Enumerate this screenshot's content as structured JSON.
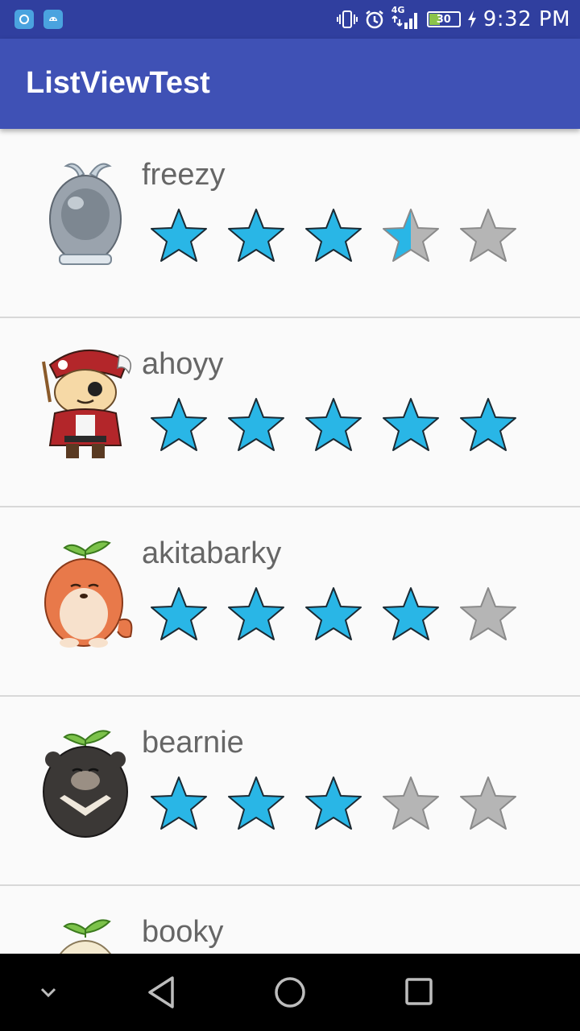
{
  "status_bar": {
    "time": "9:32 PM",
    "battery_level": "30",
    "network_type": "4G",
    "icons": [
      "app-notification-icon",
      "android-notification-icon",
      "vibrate-icon",
      "alarm-icon",
      "signal-icon",
      "battery-icon",
      "charging-icon"
    ]
  },
  "app_bar": {
    "title": "ListViewTest"
  },
  "list": {
    "items": [
      {
        "name": "freezy",
        "rating": 3.5,
        "max": 5
      },
      {
        "name": "ahoyy",
        "rating": 5,
        "max": 5
      },
      {
        "name": "akitabarky",
        "rating": 4,
        "max": 5
      },
      {
        "name": "bearnie",
        "rating": 3,
        "max": 5
      },
      {
        "name": "booky",
        "rating": null,
        "max": 5
      }
    ]
  },
  "colors": {
    "status_bar": "#303f9f",
    "app_bar": "#3f51b5",
    "star_filled": "#29b6e6",
    "star_empty": "#b5b5b5",
    "name_text": "#666666"
  },
  "nav_bar": {
    "buttons": [
      "collapse-icon",
      "back-icon",
      "home-icon",
      "recents-icon"
    ]
  }
}
